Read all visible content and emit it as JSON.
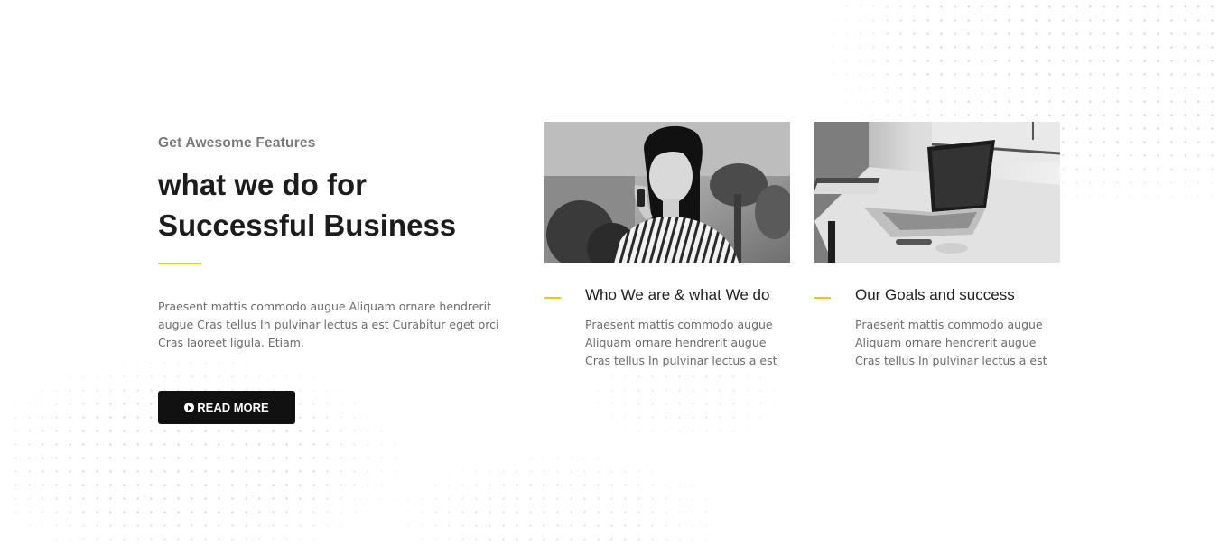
{
  "intro": {
    "eyebrow": "Get Awesome Features",
    "headline_line1": "what we do for",
    "headline_line2": "Successful Business",
    "text": "Praesent mattis commodo augue Aliquam ornare hendrerit augue Cras tellus In pulvinar lectus a est Curabitur eget orci Cras laoreet ligula. Etiam.",
    "button_label": "READ MORE",
    "button_icon": "play-circle-icon"
  },
  "cards": [
    {
      "title": "Who We are & what We do",
      "text": "Praesent mattis commodo augue Aliquam ornare hendrerit augue Cras tellus In pulvinar lectus a est",
      "image": "woman-on-phone-photo"
    },
    {
      "title": "Our Goals and success",
      "text": "Praesent mattis commodo augue Aliquam ornare hendrerit augue Cras tellus In pulvinar lectus a est",
      "image": "laptop-on-desk-photo"
    }
  ],
  "colors": {
    "accent": "#f2c511",
    "button_bg": "#111111",
    "heading": "#1c1c1c",
    "body_text": "#6b6b6b"
  }
}
